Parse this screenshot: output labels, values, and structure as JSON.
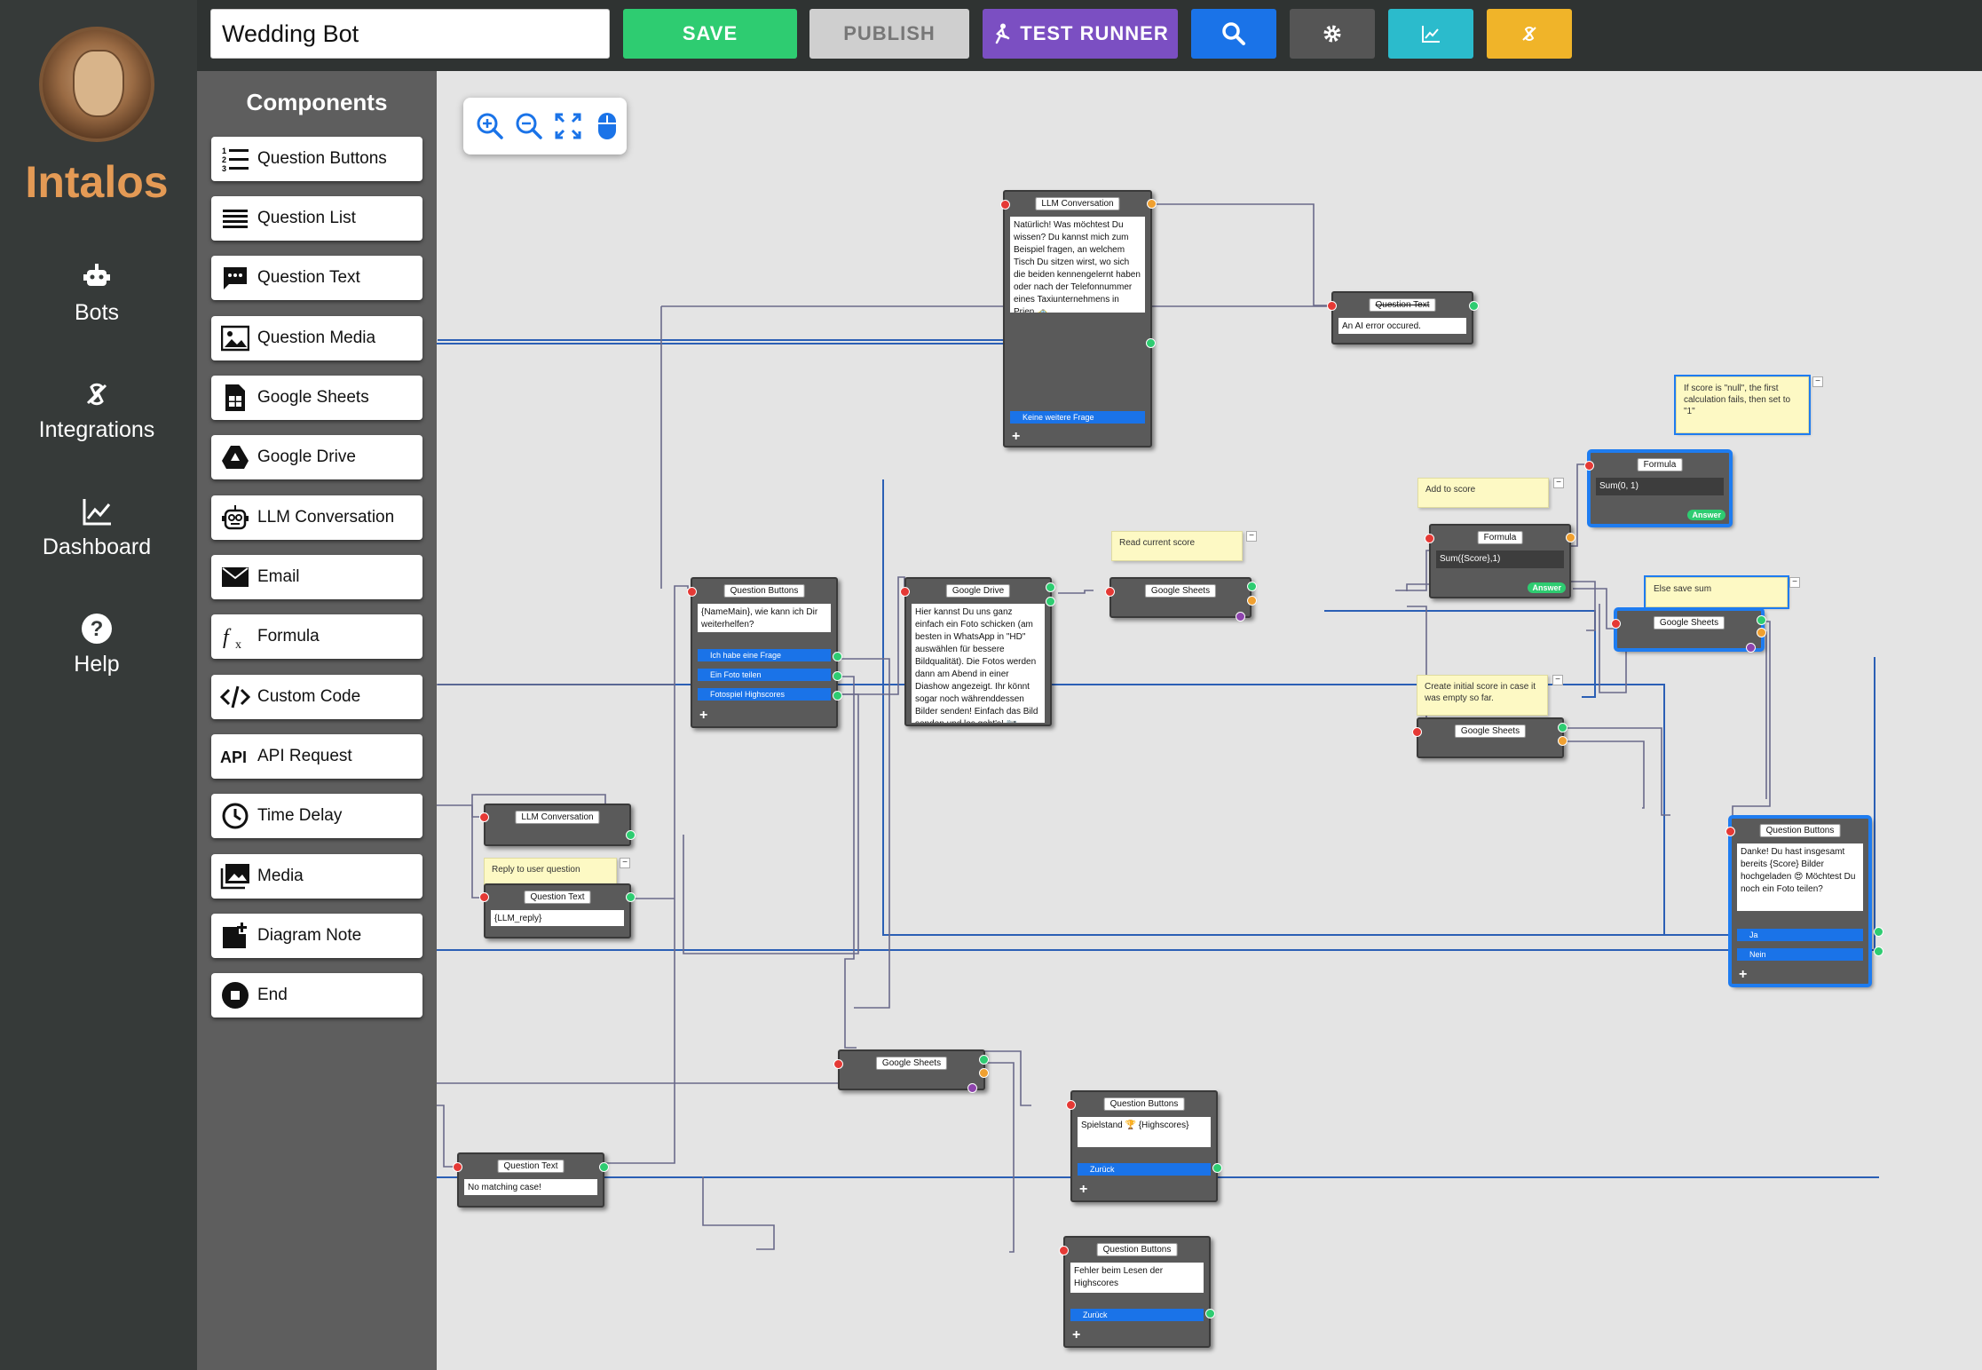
{
  "brand": {
    "name": "Intalos"
  },
  "nav": [
    {
      "label": "Bots",
      "icon": "robot-icon"
    },
    {
      "label": "Integrations",
      "icon": "plug-icon"
    },
    {
      "label": "Dashboard",
      "icon": "chart-line-icon"
    },
    {
      "label": "Help",
      "icon": "help-circle-icon"
    }
  ],
  "topbar": {
    "bot_name": "Wedding Bot",
    "save": "SAVE",
    "publish": "PUBLISH",
    "test_runner": "TEST RUNNER",
    "colors": {
      "save": "#2ecc71",
      "publish": "#cfcfcf",
      "test_runner": "#7b4fc2",
      "search": "#1a73e8",
      "settings": "#555555",
      "analytics": "#2bbbcc",
      "integrations": "#f0b429"
    }
  },
  "components": {
    "title": "Components",
    "items": [
      {
        "label": "Question Buttons",
        "icon": "numbered-list-icon"
      },
      {
        "label": "Question List",
        "icon": "list-icon"
      },
      {
        "label": "Question Text",
        "icon": "speech-bubble-icon"
      },
      {
        "label": "Question Media",
        "icon": "image-icon"
      },
      {
        "label": "Google Sheets",
        "icon": "spreadsheet-icon"
      },
      {
        "label": "Google Drive",
        "icon": "drive-icon"
      },
      {
        "label": "LLM Conversation",
        "icon": "robot-face-icon"
      },
      {
        "label": "Email",
        "icon": "envelope-icon"
      },
      {
        "label": "Formula",
        "icon": "function-icon"
      },
      {
        "label": "Custom Code",
        "icon": "code-icon"
      },
      {
        "label": "API Request",
        "icon": "api-icon"
      },
      {
        "label": "Time Delay",
        "icon": "clock-icon"
      },
      {
        "label": "Media",
        "icon": "images-icon"
      },
      {
        "label": "Diagram Note",
        "icon": "note-add-icon"
      },
      {
        "label": "End",
        "icon": "stop-icon"
      }
    ]
  },
  "zoom": {
    "icons": [
      "zoom-in-icon",
      "zoom-out-icon",
      "fit-screen-icon",
      "mouse-icon"
    ]
  },
  "nodes": {
    "llm_top": {
      "title": "LLM Conversation",
      "text": "Natürlich! Was möchtest Du wissen? Du kannst mich zum Beispiel fragen, an welchem Tisch Du sitzen wirst, wo sich die beiden kennengelernt haben oder nach der Telefonnummer eines Taxiunternehmens in Prien 🚕",
      "option": "Keine weitere Frage"
    },
    "qt_error": {
      "title": "Question Text",
      "text": "An AI error occured."
    },
    "qb_main": {
      "title": "Question Buttons",
      "text": "{NameMain}, wie kann ich Dir weiterhelfen?",
      "options": [
        "Ich habe eine Frage",
        "Ein Foto teilen",
        "Fotospiel Highscores"
      ]
    },
    "gdrive": {
      "title": "Google Drive",
      "text": "Hier kannst Du uns ganz einfach ein Foto schicken (am besten in WhatsApp in \"HD\" auswählen für bessere Bildqualität). Die Fotos werden dann am Abend in einer Diashow angezeigt. Ihr könnt sogar noch währenddessen Bilder senden! Einfach das Bild senden und los geht's! 📷"
    },
    "gs_read": {
      "title": "Google Sheets"
    },
    "note_read": {
      "text": "Read current score"
    },
    "note_add": {
      "text": "Add to score"
    },
    "formula_add": {
      "title": "Formula",
      "expr": "Sum({Score},1)",
      "pill": "Answer"
    },
    "note_null": {
      "text": "If score is \"null\", the first calculation fails, then set to \"1\""
    },
    "formula_null": {
      "title": "Formula",
      "expr": "Sum(0, 1)",
      "pill": "Answer"
    },
    "note_save": {
      "text": "Else save sum"
    },
    "gs_save": {
      "title": "Google Sheets"
    },
    "note_create": {
      "text": "Create initial score in case it was empty so far."
    },
    "gs_create": {
      "title": "Google Sheets"
    },
    "qb_thanks": {
      "title": "Question Buttons",
      "text": "Danke! Du hast insgesamt bereits {Score} Bilder hochgeladen 😍 Möchtest Du noch ein Foto teilen?",
      "options": [
        "Ja",
        "Nein"
      ]
    },
    "llm_left": {
      "title": "LLM Conversation"
    },
    "note_reply": {
      "text": "Reply to user question"
    },
    "qt_reply": {
      "title": "Question Text",
      "text": "{LLM_reply}"
    },
    "gs_scores": {
      "title": "Google Sheets"
    },
    "qb_score": {
      "title": "Question Buttons",
      "text": "Spielstand 🏆 {Highscores}",
      "option": "Zurück"
    },
    "qt_nomatch": {
      "title": "Question Text",
      "text": "No matching case!"
    },
    "qb_fail": {
      "title": "Question Buttons",
      "text": "Fehler beim Lesen der Highscores",
      "option": "Zurück"
    }
  }
}
